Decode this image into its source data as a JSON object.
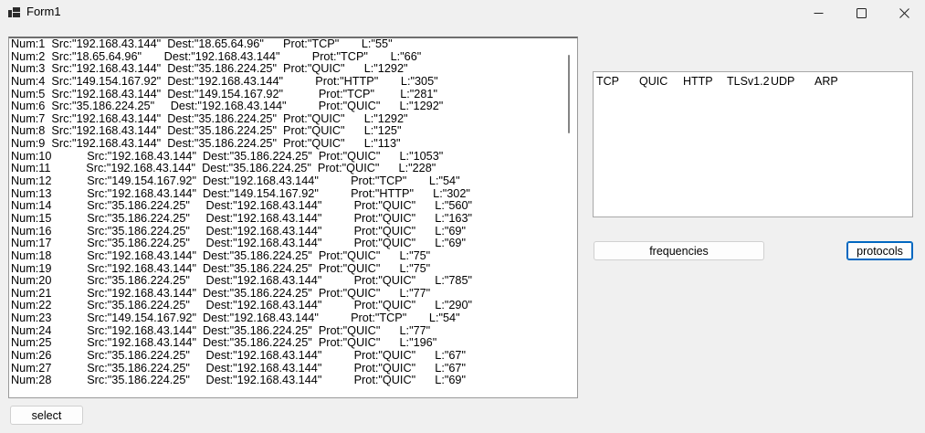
{
  "window": {
    "title": "Form1"
  },
  "packet_list": [
    "Num:1  Src:\"192.168.43.144\"  Dest:\"18.65.64.96\"      Prot:\"TCP\"       L:\"55\"",
    "Num:2  Src:\"18.65.64.96\"       Dest:\"192.168.43.144\"          Prot:\"TCP\"       L:\"66\"",
    "Num:3  Src:\"192.168.43.144\"  Dest:\"35.186.224.25\"  Prot:\"QUIC\"      L:\"1292\"",
    "Num:4  Src:\"149.154.167.92\"  Dest:\"192.168.43.144\"          Prot:\"HTTP\"       L:\"305\"",
    "Num:5  Src:\"192.168.43.144\"  Dest:\"149.154.167.92\"           Prot:\"TCP\"        L:\"281\"",
    "Num:6  Src:\"35.186.224.25\"     Dest:\"192.168.43.144\"          Prot:\"QUIC\"      L:\"1292\"",
    "Num:7  Src:\"192.168.43.144\"  Dest:\"35.186.224.25\"  Prot:\"QUIC\"      L:\"1292\"",
    "Num:8  Src:\"192.168.43.144\"  Dest:\"35.186.224.25\"  Prot:\"QUIC\"      L:\"125\"",
    "Num:9  Src:\"192.168.43.144\"  Dest:\"35.186.224.25\"  Prot:\"QUIC\"      L:\"113\"",
    "Num:10           Src:\"192.168.43.144\"  Dest:\"35.186.224.25\"  Prot:\"QUIC\"      L:\"1053\"",
    "Num:11           Src:\"192.168.43.144\"  Dest:\"35.186.224.25\"  Prot:\"QUIC\"      L:\"228\"",
    "Num:12           Src:\"149.154.167.92\"  Dest:\"192.168.43.144\"          Prot:\"TCP\"       L:\"54\"",
    "Num:13           Src:\"192.168.43.144\"  Dest:\"149.154.167.92\"          Prot:\"HTTP\"      L:\"302\"",
    "Num:14           Src:\"35.186.224.25\"     Dest:\"192.168.43.144\"          Prot:\"QUIC\"      L:\"560\"",
    "Num:15           Src:\"35.186.224.25\"     Dest:\"192.168.43.144\"          Prot:\"QUIC\"      L:\"163\"",
    "Num:16           Src:\"35.186.224.25\"     Dest:\"192.168.43.144\"          Prot:\"QUIC\"      L:\"69\"",
    "Num:17           Src:\"35.186.224.25\"     Dest:\"192.168.43.144\"          Prot:\"QUIC\"      L:\"69\"",
    "Num:18           Src:\"192.168.43.144\"  Dest:\"35.186.224.25\"  Prot:\"QUIC\"      L:\"75\"",
    "Num:19           Src:\"192.168.43.144\"  Dest:\"35.186.224.25\"  Prot:\"QUIC\"      L:\"75\"",
    "Num:20           Src:\"35.186.224.25\"     Dest:\"192.168.43.144\"          Prot:\"QUIC\"      L:\"785\"",
    "Num:21           Src:\"192.168.43.144\"  Dest:\"35.186.224.25\"  Prot:\"QUIC\"      L:\"77\"",
    "Num:22           Src:\"35.186.224.25\"     Dest:\"192.168.43.144\"          Prot:\"QUIC\"      L:\"290\"",
    "Num:23           Src:\"149.154.167.92\"  Dest:\"192.168.43.144\"          Prot:\"TCP\"       L:\"54\"",
    "Num:24           Src:\"192.168.43.144\"  Dest:\"35.186.224.25\"  Prot:\"QUIC\"      L:\"77\"",
    "Num:25           Src:\"192.168.43.144\"  Dest:\"35.186.224.25\"  Prot:\"QUIC\"      L:\"196\"",
    "Num:26           Src:\"35.186.224.25\"     Dest:\"192.168.43.144\"          Prot:\"QUIC\"      L:\"67\"",
    "Num:27           Src:\"35.186.224.25\"     Dest:\"192.168.43.144\"          Prot:\"QUIC\"      L:\"67\"",
    "Num:28           Src:\"35.186.224.25\"     Dest:\"192.168.43.144\"          Prot:\"QUIC\"      L:\"69\""
  ],
  "protocols_list": [
    "TCP",
    "QUIC",
    "HTTP",
    "TLSv1.2",
    "UDP",
    "ARP"
  ],
  "buttons": {
    "frequencies": "frequencies",
    "protocols": "protocols",
    "select": "select"
  },
  "colors": {
    "background": "#f0f0f0",
    "focus_border": "#0067c0"
  }
}
